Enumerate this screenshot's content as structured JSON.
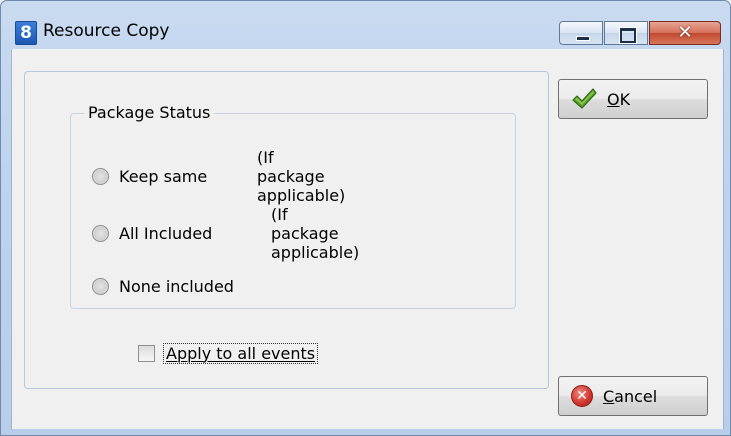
{
  "window": {
    "app_icon_text": "8",
    "title": "Resource Copy",
    "minimize_icon": "minimize-icon",
    "maximize_icon": "maximize-icon",
    "close_icon": "close-icon",
    "close_glyph": "✕"
  },
  "package_status": {
    "legend": "Package Status",
    "options": [
      {
        "label": "Keep same",
        "note": "(If package applicable)",
        "selected": false
      },
      {
        "label": "All Included",
        "note": "(If package applicable)",
        "selected": false
      },
      {
        "label": "None included",
        "note": "",
        "selected": false
      }
    ]
  },
  "apply_all": {
    "label": "Apply to all events",
    "checked": false
  },
  "buttons": {
    "ok": {
      "mnemonic": "O",
      "rest": "K",
      "icon": "checkmark-icon"
    },
    "cancel": {
      "mnemonic": "C",
      "rest": "ancel",
      "icon": "cancel-icon",
      "icon_glyph": "✕"
    }
  }
}
